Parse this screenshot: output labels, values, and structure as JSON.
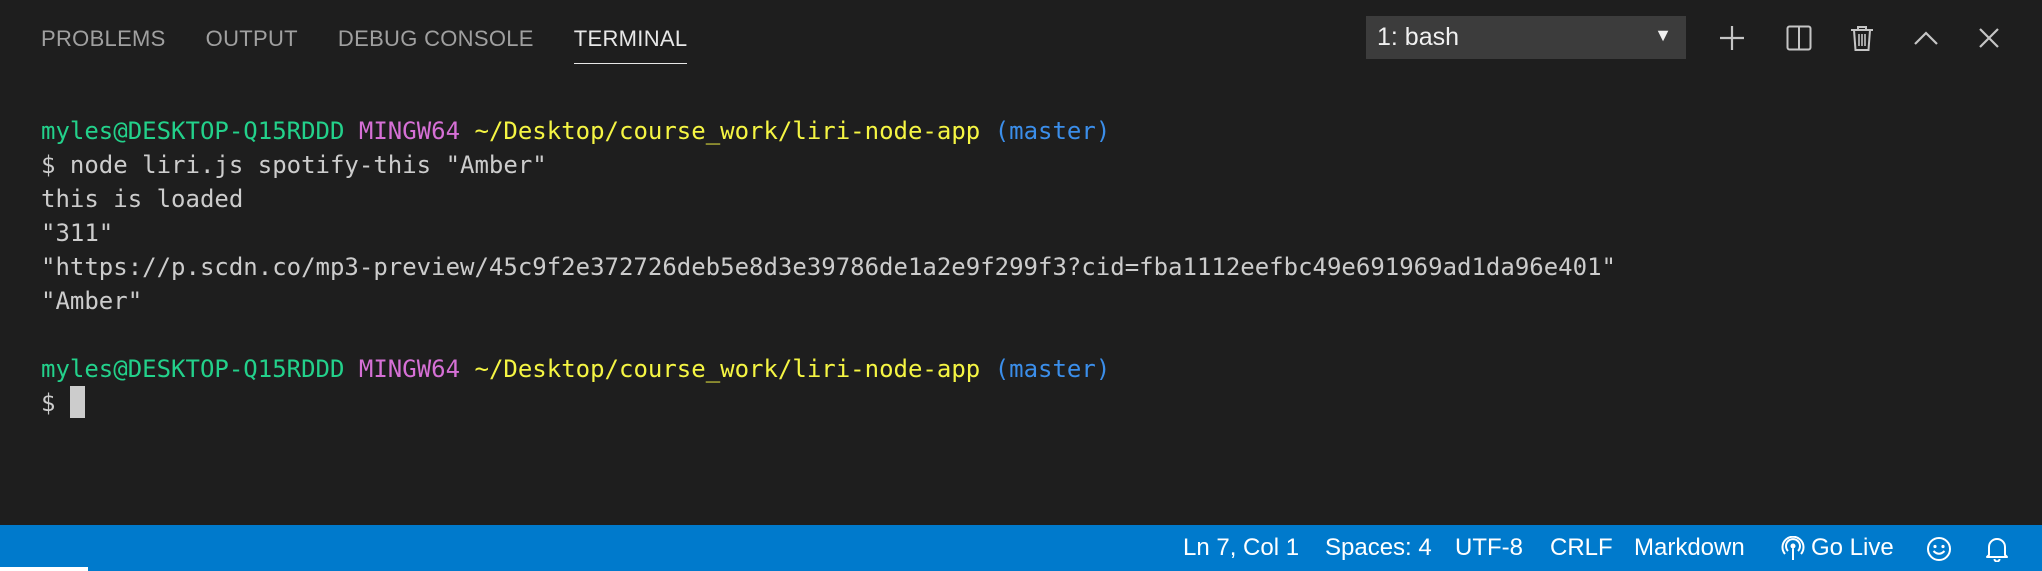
{
  "panel": {
    "tabs": [
      {
        "label": "PROBLEMS"
      },
      {
        "label": "OUTPUT"
      },
      {
        "label": "DEBUG CONSOLE"
      },
      {
        "label": "TERMINAL",
        "active": true
      }
    ],
    "terminal_select": {
      "selected": "1: bash"
    },
    "actions": [
      {
        "icon": "plus-icon"
      },
      {
        "icon": "split-icon"
      },
      {
        "icon": "trash-icon"
      },
      {
        "icon": "chevron-up-icon"
      },
      {
        "icon": "close-icon"
      }
    ]
  },
  "terminal": {
    "prompt1": {
      "user": "myles@DESKTOP-Q15RDDD",
      "host": "MINGW64",
      "path": "~/Desktop/course_work/liri-node-app",
      "branch": "(master)"
    },
    "command": "$ node liri.js spotify-this \"Amber\"",
    "output": [
      "this is loaded",
      "\"311\"",
      "\"https://p.scdn.co/mp3-preview/45c9f2e372726deb5e8d3e39786de1a2e9f299f3?cid=fba1112eefbc49e691969ad1da96e401\"",
      "\"Amber\""
    ],
    "prompt2": {
      "user": "myles@DESKTOP-Q15RDDD",
      "host": "MINGW64",
      "path": "~/Desktop/course_work/liri-node-app",
      "branch": "(master)"
    },
    "input_prompt": "$"
  },
  "status_bar": {
    "position": "Ln 7, Col 1",
    "spaces": "Spaces: 4",
    "encoding": "UTF-8",
    "eol": "CRLF",
    "language": "Markdown",
    "go_live": "Go Live"
  },
  "colors": {
    "background": "#1e1e1e",
    "status_bar": "#007acc",
    "user": "#23d18b",
    "host": "#d670d6",
    "path": "#f5f543",
    "branch": "#3b8eea"
  }
}
